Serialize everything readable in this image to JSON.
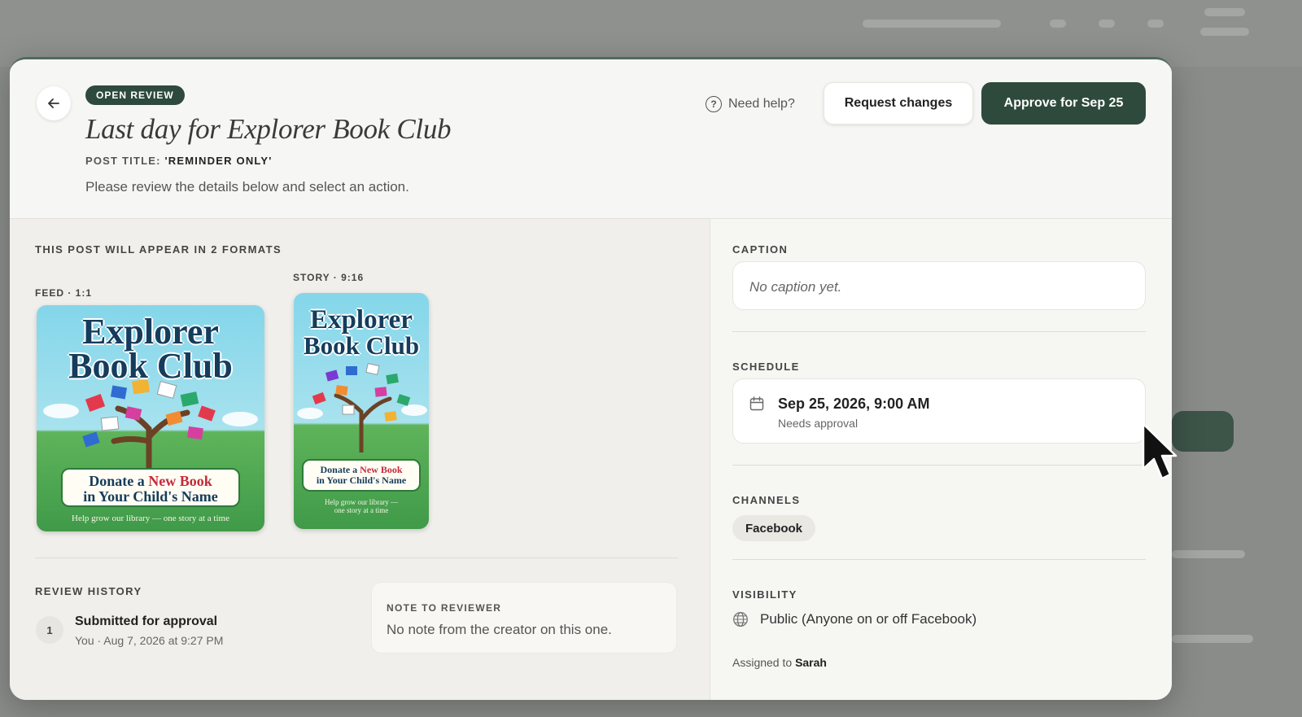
{
  "background": {
    "brand_color": "#2e4a3c"
  },
  "header": {
    "badge": "OPEN REVIEW",
    "title": "Last day for Explorer Book Club",
    "post_title_label": "POST TITLE:",
    "post_title_value": "'REMINDER ONLY'",
    "instructions": "Please review the details below and select an action.",
    "help_label": "Need help?",
    "request_changes_label": "Request changes",
    "approve_label": "Approve for Sep 25"
  },
  "formats": {
    "heading": "THIS POST WILL APPEAR IN 2 FORMATS",
    "feed_label": "FEED · 1:1",
    "story_label": "STORY · 9:16",
    "poster": {
      "line1": "Explorer",
      "line2": "Book Club",
      "banner_line1_a": "Donate a",
      "banner_line1_b": "New Book",
      "banner_line2": "in Your Child's Name",
      "tagline": "Help grow our library — one story at a time",
      "story_tagline_1": "Help grow our library —",
      "story_tagline_2": "one story at a time"
    }
  },
  "history": {
    "heading": "REVIEW HISTORY",
    "items": [
      {
        "num": "1",
        "title": "Submitted for approval",
        "meta": "You · Aug 7, 2026 at 9:27 PM"
      }
    ]
  },
  "note": {
    "label": "NOTE TO REVIEWER",
    "text": "No note from the creator on this one."
  },
  "caption": {
    "label": "CAPTION",
    "placeholder": "No caption yet."
  },
  "schedule": {
    "label": "SCHEDULE",
    "datetime": "Sep 25, 2026, 9:00 AM",
    "status": "Needs approval"
  },
  "channels": {
    "label": "CHANNELS",
    "items": [
      "Facebook"
    ]
  },
  "visibility": {
    "label": "VISIBILITY",
    "value": "Public (Anyone on or off Facebook)"
  },
  "assignment": {
    "prefix": "Assigned to",
    "assignee": "Sarah"
  }
}
